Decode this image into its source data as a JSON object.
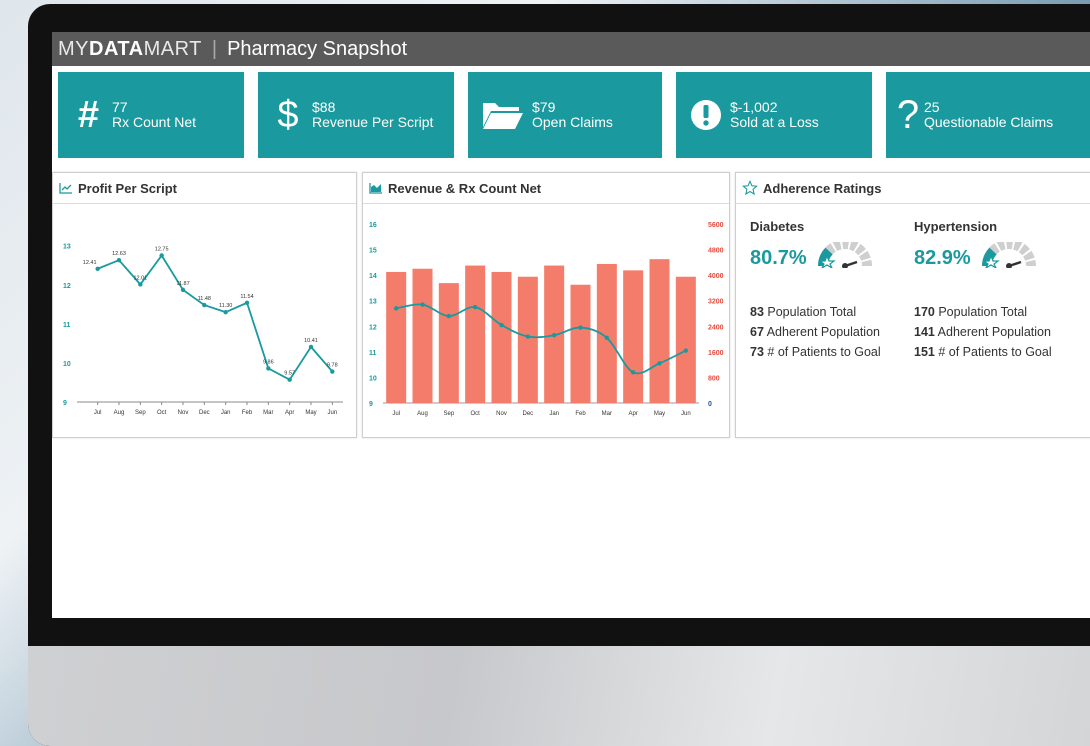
{
  "brand": {
    "prefix": "MY",
    "bold": "DATA",
    "suffix": "MART",
    "separator": "|"
  },
  "app_title": "Pharmacy Snapshot",
  "kpis": [
    {
      "icon": "hash-icon",
      "value": "77",
      "label": "Rx Count Net"
    },
    {
      "icon": "dollar-icon",
      "value": "$88",
      "label": "Revenue Per Script"
    },
    {
      "icon": "folder-icon",
      "value": "$79",
      "label": "Open Claims"
    },
    {
      "icon": "alert-icon",
      "value": "$-1,002",
      "label": "Sold at a Loss"
    },
    {
      "icon": "question-icon",
      "value": "25",
      "label": "Questionable Claims"
    }
  ],
  "panels": {
    "profit": {
      "title": "Profit Per Script",
      "icon": "line-chart-icon"
    },
    "revenue": {
      "title": "Revenue & Rx Count Net",
      "icon": "area-chart-icon"
    },
    "adherence": {
      "title": "Adherence Ratings",
      "icon": "star-icon"
    }
  },
  "adherence": [
    {
      "name": "Diabetes",
      "pct": "80.7%",
      "pop_total": "83",
      "pop_total_label": "Population Total",
      "adherent": "67",
      "adherent_label": "Adherent Population",
      "to_goal": "73",
      "to_goal_label": "# of Patients to Goal"
    },
    {
      "name": "Hypertension",
      "pct": "82.9%",
      "pop_total": "170",
      "pop_total_label": "Population Total",
      "adherent": "141",
      "adherent_label": "Adherent Population",
      "to_goal": "151",
      "to_goal_label": "# of Patients to Goal"
    }
  ],
  "colors": {
    "teal": "#1a9a9e",
    "bar": "#f47c6a",
    "axis_left": "#1a9a9e",
    "axis_right": "#e84c3d"
  },
  "chart_data": [
    {
      "type": "line",
      "title": "Profit Per Script",
      "categories": [
        "Jul",
        "Aug",
        "Sep",
        "Oct",
        "Nov",
        "Dec",
        "Jan",
        "Feb",
        "Mar",
        "Apr",
        "May",
        "Jun"
      ],
      "values": [
        12.41,
        12.63,
        12.01,
        12.75,
        11.87,
        11.48,
        11.3,
        11.54,
        9.86,
        9.57,
        10.41,
        9.78
      ],
      "yticks": [
        9,
        10,
        11,
        12,
        13
      ],
      "ylim": [
        9,
        13.3
      ]
    },
    {
      "type": "bar",
      "title": "Revenue & Rx Count Net",
      "categories": [
        "Jul",
        "Aug",
        "Sep",
        "Oct",
        "Nov",
        "Dec",
        "Jan",
        "Feb",
        "Mar",
        "Apr",
        "May",
        "Jun"
      ],
      "series": [
        {
          "axis": "right",
          "type": "bar",
          "values": [
            4100,
            4200,
            3750,
            4300,
            4100,
            3950,
            4300,
            3700,
            4350,
            4150,
            4500,
            3950
          ]
        },
        {
          "axis": "left",
          "type": "line",
          "values": [
            12.7,
            12.85,
            12.4,
            12.75,
            12.05,
            11.6,
            11.65,
            11.95,
            11.55,
            10.2,
            10.55,
            11.05
          ]
        }
      ],
      "yticks_left": [
        9,
        10,
        11,
        12,
        13,
        14,
        15,
        16
      ],
      "ylim_left": [
        9,
        16
      ],
      "yticks_right": [
        0,
        800,
        1600,
        2400,
        3200,
        4000,
        4800,
        5600
      ],
      "ylim_right": [
        0,
        5600
      ]
    }
  ]
}
